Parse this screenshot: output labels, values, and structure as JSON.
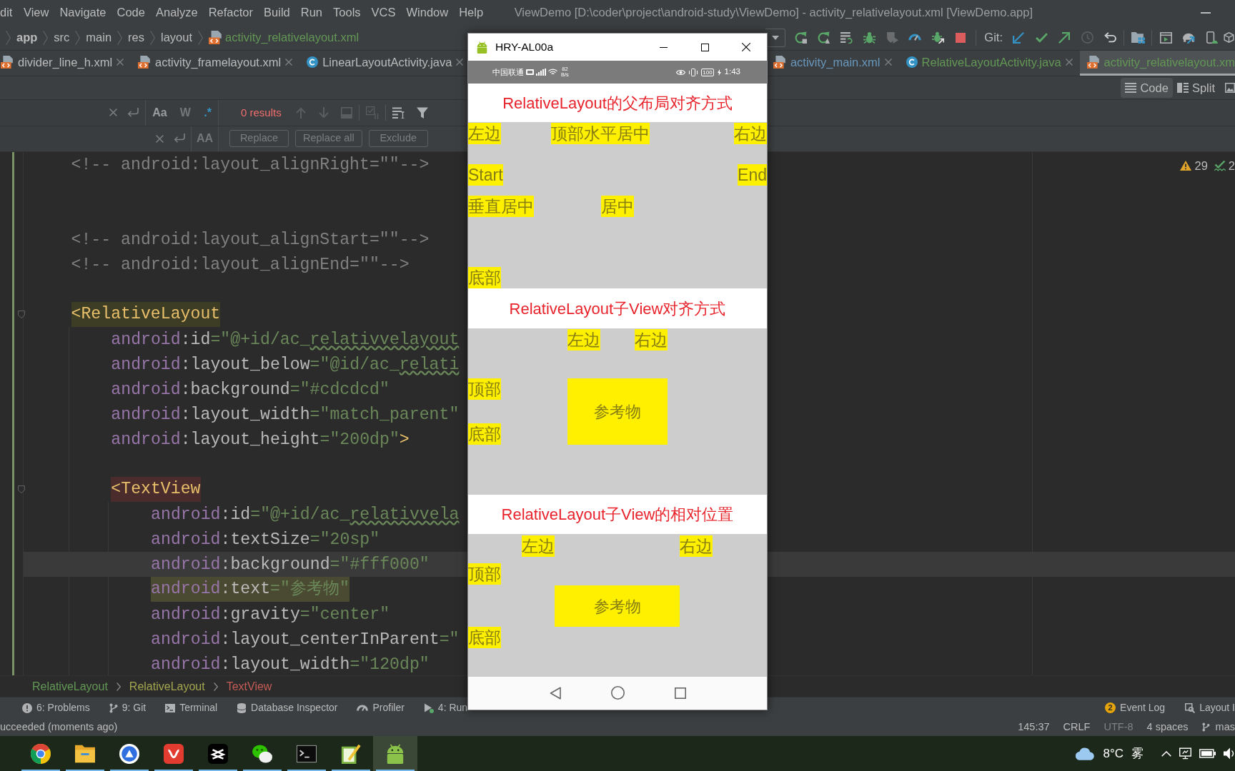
{
  "menu_bar": {
    "menus": [
      "dit",
      "View",
      "Navigate",
      "Code",
      "Analyze",
      "Refactor",
      "Build",
      "Run",
      "Tools",
      "VCS",
      "Window",
      "Help"
    ],
    "title": "ViewDemo [D:\\coder\\project\\android-study\\ViewDemo] - activity_relativelayout.xml [ViewDemo.app]"
  },
  "navigation_bar": {
    "path": [
      {
        "kind": "module",
        "label": "app"
      },
      {
        "kind": "folder",
        "label": "src"
      },
      {
        "kind": "folder",
        "label": "main"
      },
      {
        "kind": "folder",
        "label": "res"
      },
      {
        "kind": "folder",
        "label": "layout"
      },
      {
        "kind": "file",
        "label": "activity_relativelayout.xml"
      }
    ],
    "git_label": "Git:"
  },
  "tab_groups": [
    {
      "tabs": [
        {
          "kind": "xml",
          "label": "divider_line_h.xml",
          "color": "#bbbbbb",
          "selected": false,
          "closable": true
        },
        {
          "kind": "xml",
          "label": "activity_framelayout.xml",
          "color": "#bbbbbb",
          "selected": false,
          "closable": true
        },
        {
          "kind": "java",
          "label": "LinearLayoutActivity.java",
          "color": "#bbbbbb",
          "selected": false,
          "closable": true
        }
      ]
    },
    {
      "tabs": [
        {
          "kind": "xml",
          "label": "activity_main.xml",
          "color": "#6897bb",
          "selected": false,
          "closable": true
        },
        {
          "kind": "java",
          "label": "RelativeLayoutActivity.java",
          "color": "#629755",
          "selected": false,
          "closable": true
        },
        {
          "kind": "xml",
          "label": "activity_relativelayout.xm",
          "color": "#629755",
          "selected": true,
          "closable": false
        }
      ]
    }
  ],
  "view_modes": [
    {
      "kind": "code",
      "label": "Code",
      "selected": true
    },
    {
      "kind": "split",
      "label": "Split",
      "selected": false
    }
  ],
  "find_panel": {
    "options": [
      {
        "label": "Aa",
        "selected": false,
        "disabled": false
      },
      {
        "label": "W",
        "selected": false,
        "disabled": true
      },
      {
        "label": ".*",
        "selected": true,
        "disabled": false
      }
    ],
    "results": "0 results",
    "replace_options": [
      {
        "label": "AA",
        "selected": false,
        "disabled": true
      }
    ],
    "buttons": [
      {
        "label": "Replace",
        "disabled": true
      },
      {
        "label": "Replace all",
        "disabled": true
      },
      {
        "label": "Exclude",
        "disabled": true
      }
    ]
  },
  "editor": {
    "lines": [
      {
        "kind": "code",
        "current": false,
        "parts": [
          {
            "kind": "comment",
            "text": "<!-- android:layout_alignRight=\"\"-->"
          }
        ]
      },
      {
        "kind": "blank",
        "current": false
      },
      {
        "kind": "blank",
        "current": false
      },
      {
        "kind": "code",
        "current": false,
        "parts": [
          {
            "kind": "comment",
            "text": "<!-- android:layout_alignStart=\"\"-->"
          }
        ]
      },
      {
        "kind": "code",
        "current": false,
        "parts": [
          {
            "kind": "comment",
            "text": "<!-- android:layout_alignEnd=\"\"-->"
          }
        ]
      },
      {
        "kind": "blank",
        "current": false
      },
      {
        "kind": "code",
        "current": false,
        "color": "#3d3c25",
        "parts": [
          {
            "kind": "tag",
            "text": "<RelativeLayout"
          }
        ],
        "children": [
          {
            "kind": "code",
            "current": false,
            "parts": [
              {
                "kind": "namespace",
                "text": "android"
              },
              {
                "kind": "attribute",
                "text": ":id"
              },
              {
                "kind": "value",
                "text": "=\"@+id/ac_"
              },
              {
                "kind": "typo",
                "text": "relativvelayout"
              }
            ]
          },
          {
            "kind": "code",
            "current": false,
            "parts": [
              {
                "kind": "namespace",
                "text": "android"
              },
              {
                "kind": "attribute",
                "text": ":layout_below"
              },
              {
                "kind": "value",
                "text": "=\"@id/ac_"
              },
              {
                "kind": "typo",
                "text": "relati"
              }
            ]
          },
          {
            "kind": "code",
            "current": false,
            "parts": [
              {
                "kind": "namespace",
                "text": "android"
              },
              {
                "kind": "attribute",
                "text": ":background"
              },
              {
                "kind": "value",
                "text": "=\"#cdcdcd\""
              }
            ]
          },
          {
            "kind": "code",
            "current": false,
            "parts": [
              {
                "kind": "namespace",
                "text": "android"
              },
              {
                "kind": "attribute",
                "text": ":layout_width"
              },
              {
                "kind": "value",
                "text": "=\"match_parent\""
              }
            ]
          },
          {
            "kind": "code",
            "current": false,
            "parts": [
              {
                "kind": "namespace",
                "text": "android"
              },
              {
                "kind": "attribute",
                "text": ":layout_height"
              },
              {
                "kind": "value",
                "text": "=\"200dp\""
              },
              {
                "kind": "tag",
                "text": ">"
              }
            ]
          },
          {
            "kind": "blank",
            "current": false
          },
          {
            "kind": "code",
            "current": false,
            "color": "#4a2c2c",
            "parts": [
              {
                "kind": "tag",
                "text": "<TextView"
              }
            ],
            "children": [
              {
                "kind": "code",
                "current": false,
                "parts": [
                  {
                    "kind": "namespace",
                    "text": "android"
                  },
                  {
                    "kind": "attribute",
                    "text": ":id"
                  },
                  {
                    "kind": "value",
                    "text": "=\"@+id/ac_"
                  },
                  {
                    "kind": "typo",
                    "text": "relativvela"
                  }
                ]
              },
              {
                "kind": "code",
                "current": false,
                "parts": [
                  {
                    "kind": "namespace",
                    "text": "android"
                  },
                  {
                    "kind": "attribute",
                    "text": ":textSize"
                  },
                  {
                    "kind": "value",
                    "text": "=\"20sp\""
                  }
                ]
              },
              {
                "kind": "code",
                "current": true,
                "parts": [
                  {
                    "kind": "namespace",
                    "text": "android"
                  },
                  {
                    "kind": "attribute",
                    "text": ":background"
                  },
                  {
                    "kind": "value",
                    "text": "=\"#fff000\""
                  }
                ]
              },
              {
                "kind": "code",
                "current": false,
                "color": "#4a4931",
                "parts": [
                  {
                    "kind": "namespace",
                    "text": "android"
                  },
                  {
                    "kind": "attribute",
                    "text": ":text"
                  },
                  {
                    "kind": "value",
                    "text": "=\"参考物\""
                  }
                ]
              },
              {
                "kind": "code",
                "current": false,
                "parts": [
                  {
                    "kind": "namespace",
                    "text": "android"
                  },
                  {
                    "kind": "attribute",
                    "text": ":gravity"
                  },
                  {
                    "kind": "value",
                    "text": "=\"center\""
                  }
                ]
              },
              {
                "kind": "code",
                "current": false,
                "parts": [
                  {
                    "kind": "namespace",
                    "text": "android"
                  },
                  {
                    "kind": "attribute",
                    "text": ":layout_centerInParent"
                  },
                  {
                    "kind": "value",
                    "text": "=\""
                  }
                ]
              },
              {
                "kind": "code",
                "current": false,
                "parts": [
                  {
                    "kind": "namespace",
                    "text": "android"
                  },
                  {
                    "kind": "attribute",
                    "text": ":layout_width"
                  },
                  {
                    "kind": "value",
                    "text": "=\"120dp\""
                  }
                ]
              }
            ]
          }
        ]
      }
    ],
    "inspections": [
      {
        "kind": "warning",
        "count": "29"
      },
      {
        "kind": "typo",
        "count": "2"
      }
    ]
  },
  "breadcrumbs": [
    {
      "label": "RelativeLayout",
      "color": "#629755"
    },
    {
      "label": "RelativeLayout",
      "color": "#a3a64e"
    },
    {
      "label": "TextView",
      "color": "#c45c55"
    }
  ],
  "tool_windows": {
    "left": [
      {
        "kind": "problems",
        "label": "6: Problems"
      },
      {
        "kind": "git",
        "label": "9: Git"
      },
      {
        "kind": "terminal",
        "label": "Terminal"
      },
      {
        "kind": "database",
        "label": "Database Inspector"
      },
      {
        "kind": "profiler",
        "label": "Profiler"
      },
      {
        "kind": "run",
        "label": "4: Run"
      }
    ],
    "right": [
      {
        "kind": "event_log",
        "label": "Event Log",
        "badge": "2"
      },
      {
        "kind": "layout_inspector",
        "label": "Layout I"
      }
    ]
  },
  "status_bar": {
    "message": "ucceeded (moments ago)",
    "items": [
      {
        "kind": "text",
        "label": "145:37",
        "disabled": false
      },
      {
        "kind": "text",
        "label": "CRLF",
        "disabled": false
      },
      {
        "kind": "text",
        "label": "UTF-8",
        "disabled": true
      },
      {
        "kind": "text",
        "label": "4 spaces",
        "disabled": false
      },
      {
        "kind": "branch",
        "label": "mas",
        "disabled": false
      }
    ]
  },
  "device_window": {
    "title": "HRY-AL00a",
    "status_bar": {
      "carrier": "中国联通",
      "speed_value": "82",
      "speed_unit": "B/s",
      "battery": "100",
      "time": "1:43"
    },
    "sections": [
      {
        "header": "RelativeLayout的父布局对齐方式",
        "items": [
          {
            "kind": "label",
            "text": "左边"
          },
          {
            "kind": "label",
            "text": "顶部水平居中"
          },
          {
            "kind": "label",
            "text": "右边"
          },
          {
            "kind": "label",
            "text": "Start"
          },
          {
            "kind": "label",
            "text": "End"
          },
          {
            "kind": "label",
            "text": "垂直居中"
          },
          {
            "kind": "label",
            "text": "居中"
          },
          {
            "kind": "label",
            "text": "底部"
          }
        ]
      },
      {
        "header": "RelativeLayout子View对齐方式",
        "items": [
          {
            "kind": "label",
            "text": "左边"
          },
          {
            "kind": "label",
            "text": "右边"
          },
          {
            "kind": "label",
            "text": "顶部"
          },
          {
            "kind": "reference",
            "text": "参考物"
          },
          {
            "kind": "label",
            "text": "底部"
          }
        ]
      },
      {
        "header": "RelativeLayout子View的相对位置",
        "items": [
          {
            "kind": "label",
            "text": "左边"
          },
          {
            "kind": "label",
            "text": "右边"
          },
          {
            "kind": "label",
            "text": "顶部"
          },
          {
            "kind": "reference",
            "text": "参考物"
          },
          {
            "kind": "label",
            "text": "底部"
          }
        ]
      }
    ]
  },
  "taskbar": {
    "apps": [
      {
        "kind": "browser",
        "running": true,
        "selected": false
      },
      {
        "kind": "files",
        "running": true,
        "selected": false
      },
      {
        "kind": "circle_app",
        "running": true,
        "selected": false
      },
      {
        "kind": "office",
        "running": true,
        "selected": false
      },
      {
        "kind": "video_editor",
        "running": true,
        "selected": false
      },
      {
        "kind": "chat",
        "running": true,
        "selected": false
      },
      {
        "kind": "console",
        "running": true,
        "selected": false
      },
      {
        "kind": "notepad",
        "running": true,
        "selected": false
      },
      {
        "kind": "android",
        "running": true,
        "selected": true
      }
    ],
    "weather": {
      "temperature": "8°C",
      "condition": "雾"
    }
  }
}
